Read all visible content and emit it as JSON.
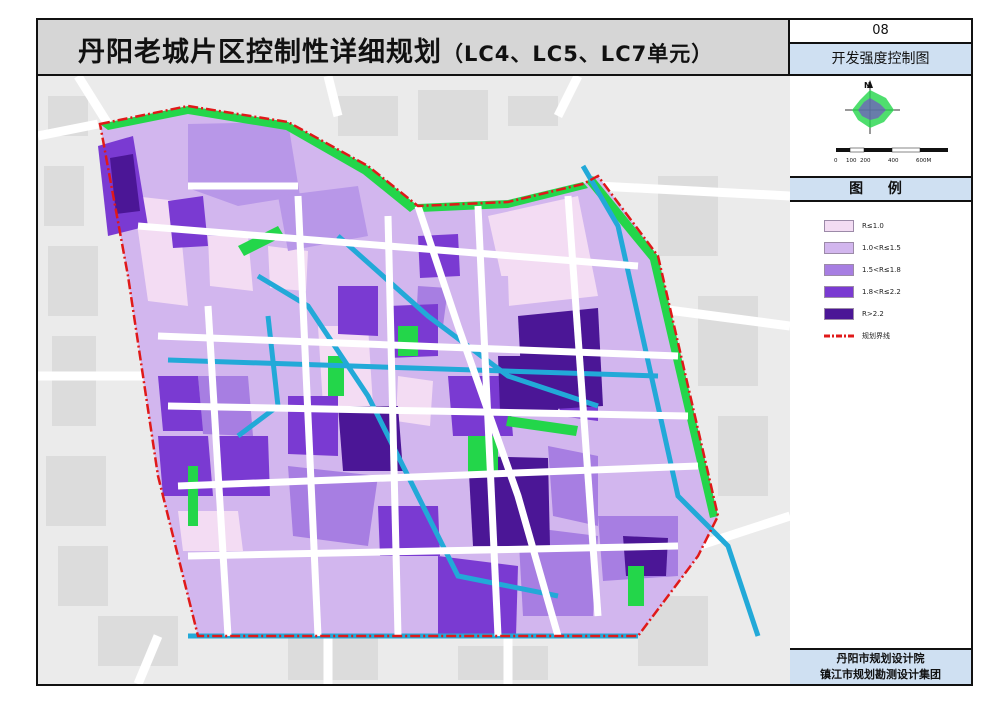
{
  "title": {
    "main": "丹阳老城片区控制性详细规划",
    "sub": "（LC4、LC5、LC7单元）"
  },
  "sheet": {
    "number": "08",
    "name": "开发强度控制图"
  },
  "compass": {
    "north": "N",
    "scale_labels": [
      "0",
      "100",
      "200",
      "400",
      "600M"
    ]
  },
  "legend": {
    "heading": "图 例",
    "items": [
      {
        "label": "R≤1.0",
        "color": "#f3dcf3"
      },
      {
        "label": "1.0<R≤1.5",
        "color": "#d2b6ee"
      },
      {
        "label": "1.5<R≤1.8",
        "color": "#a77ee2"
      },
      {
        "label": "1.8<R≤2.2",
        "color": "#7a3ad2"
      },
      {
        "label": "R>2.2",
        "color": "#4b1696"
      },
      {
        "label": "规划界线",
        "color": "#e01919"
      }
    ]
  },
  "credits": {
    "line1": "丹阳市规划设计院",
    "line2": "镇江市规划勘测设计集团"
  },
  "colors": {
    "green_space": "#23d64a",
    "water": "#22a9d8",
    "boundary": "#e01919",
    "road": "#ffffff",
    "background": "#ebebeb",
    "header_blue": "#cfe0f2",
    "title_gray": "#d6d6d6"
  }
}
